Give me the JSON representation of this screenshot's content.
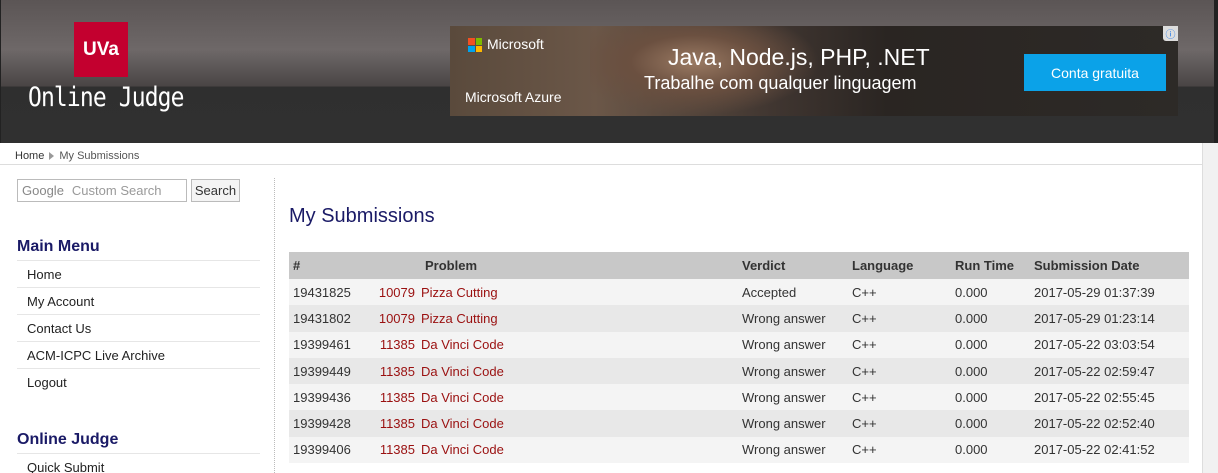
{
  "header": {
    "logo_short": "UVa",
    "logo_title": "Online Judge",
    "ad": {
      "brand": "Microsoft",
      "product": "Microsoft Azure",
      "headline": "Java, Node.js, PHP, .NET",
      "subline": "Trabalhe com qualquer linguagem",
      "cta": "Conta gratuita",
      "info_icon": "ⓘ",
      "logo_colors": [
        "#f25022",
        "#7fba00",
        "#00a4ef",
        "#ffb900"
      ]
    }
  },
  "breadcrumb": {
    "home": "Home",
    "current": "My Submissions"
  },
  "sidebar": {
    "search": {
      "google_label": "Google",
      "placeholder": "Custom Search",
      "button": "Search"
    },
    "main_menu": {
      "title": "Main Menu",
      "items": [
        "Home",
        "My Account",
        "Contact Us",
        "ACM-ICPC Live Archive",
        "Logout"
      ]
    },
    "online_judge": {
      "title": "Online Judge",
      "items": [
        "Quick Submit"
      ]
    }
  },
  "main": {
    "title": "My Submissions",
    "columns": {
      "id": "#",
      "problem": "Problem",
      "verdict": "Verdict",
      "language": "Language",
      "runtime": "Run Time",
      "date": "Submission Date"
    },
    "rows": [
      {
        "id": "19431825",
        "pnum": "10079",
        "pname": "Pizza Cutting",
        "verdict": "Accepted",
        "lang": "C++",
        "time": "0.000",
        "date": "2017-05-29 01:37:39"
      },
      {
        "id": "19431802",
        "pnum": "10079",
        "pname": "Pizza Cutting",
        "verdict": "Wrong answer",
        "lang": "C++",
        "time": "0.000",
        "date": "2017-05-29 01:23:14"
      },
      {
        "id": "19399461",
        "pnum": "11385",
        "pname": "Da Vinci Code",
        "verdict": "Wrong answer",
        "lang": "C++",
        "time": "0.000",
        "date": "2017-05-22 03:03:54"
      },
      {
        "id": "19399449",
        "pnum": "11385",
        "pname": "Da Vinci Code",
        "verdict": "Wrong answer",
        "lang": "C++",
        "time": "0.000",
        "date": "2017-05-22 02:59:47"
      },
      {
        "id": "19399436",
        "pnum": "11385",
        "pname": "Da Vinci Code",
        "verdict": "Wrong answer",
        "lang": "C++",
        "time": "0.000",
        "date": "2017-05-22 02:55:45"
      },
      {
        "id": "19399428",
        "pnum": "11385",
        "pname": "Da Vinci Code",
        "verdict": "Wrong answer",
        "lang": "C++",
        "time": "0.000",
        "date": "2017-05-22 02:52:40"
      },
      {
        "id": "19399406",
        "pnum": "11385",
        "pname": "Da Vinci Code",
        "verdict": "Wrong answer",
        "lang": "C++",
        "time": "0.000",
        "date": "2017-05-22 02:41:52"
      }
    ]
  }
}
